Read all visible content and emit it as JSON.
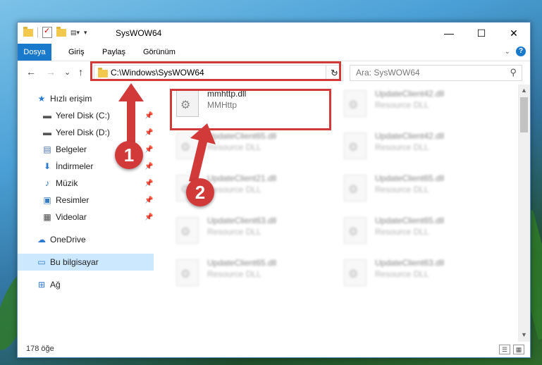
{
  "window": {
    "title": "SysWOW64",
    "controls": {
      "minimize": "—",
      "maximize": "☐",
      "close": "✕"
    }
  },
  "ribbon": {
    "tabs": [
      "Dosya",
      "Giriş",
      "Paylaş",
      "Görünüm"
    ],
    "expand_icon": "chevron-down-icon",
    "help_icon": "?"
  },
  "navigation": {
    "back": "←",
    "forward": "→",
    "recent": "⌄",
    "up": "↑",
    "address": "C:\\Windows\\SysWOW64",
    "refresh": "↻",
    "search_placeholder": "Ara: SysWOW64"
  },
  "sidebar": {
    "items": [
      {
        "label": "Hızlı erişim",
        "icon": "star-icon",
        "glyph": "★",
        "color": "#2b79d0",
        "pinned": false
      },
      {
        "label": "Yerel Disk (C:)",
        "icon": "drive-icon",
        "glyph": "▬",
        "color": "#555555",
        "pinned": true
      },
      {
        "label": "Yerel Disk (D:)",
        "icon": "drive-icon",
        "glyph": "▬",
        "color": "#555555",
        "pinned": true
      },
      {
        "label": "Belgeler",
        "icon": "document-icon",
        "glyph": "▤",
        "color": "#4a6fa5",
        "pinned": true
      },
      {
        "label": "İndirmeler",
        "icon": "download-icon",
        "glyph": "⬇",
        "color": "#2b79d0",
        "pinned": true
      },
      {
        "label": "Müzik",
        "icon": "music-icon",
        "glyph": "♪",
        "color": "#2b79d0",
        "pinned": true
      },
      {
        "label": "Resimler",
        "icon": "pictures-icon",
        "glyph": "▣",
        "color": "#3a7bbf",
        "pinned": true
      },
      {
        "label": "Videolar",
        "icon": "video-icon",
        "glyph": "▦",
        "color": "#444444",
        "pinned": true
      },
      {
        "label": "OneDrive",
        "icon": "cloud-icon",
        "glyph": "☁",
        "color": "#2b79d0",
        "pinned": false
      },
      {
        "label": "Bu bilgisayar",
        "icon": "computer-icon",
        "glyph": "▭",
        "color": "#2b79d0",
        "pinned": false,
        "selected": true
      },
      {
        "label": "Ağ",
        "icon": "network-icon",
        "glyph": "⊞",
        "color": "#2b79d0",
        "pinned": false
      }
    ]
  },
  "files": {
    "highlighted": {
      "name": "mmhttp.dll",
      "desc": "MMHttp"
    },
    "col1": [
      {
        "name": "UpdateClient65.dll",
        "desc": "Resource DLL"
      },
      {
        "name": "UpdateClient21.dll",
        "desc": "Resource DLL"
      },
      {
        "name": "UpdateClient63.dll",
        "desc": "Resource DLL"
      },
      {
        "name": "UpdateClient65.dll",
        "desc": "Resource DLL"
      }
    ],
    "col2": [
      {
        "name": "UpdateClient42.dll",
        "desc": "Resource DLL"
      },
      {
        "name": "UpdateClient42.dll",
        "desc": "Resource DLL"
      },
      {
        "name": "UpdateClient65.dll",
        "desc": "Resource DLL"
      },
      {
        "name": "UpdateClient65.dll",
        "desc": "Resource DLL"
      },
      {
        "name": "UpdateClient63.dll",
        "desc": "Resource DLL"
      }
    ]
  },
  "status": {
    "count": "178 öğe"
  },
  "callouts": [
    "1",
    "2"
  ],
  "colors": {
    "accent": "#1979ca",
    "highlight": "#d23a3a",
    "selected": "#cce8ff"
  }
}
